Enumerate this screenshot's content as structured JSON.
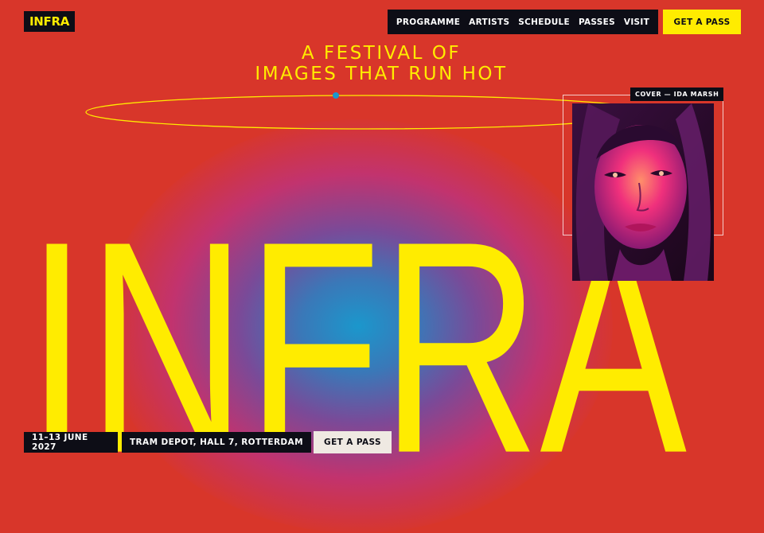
{
  "brand": {
    "logo": "INFRA"
  },
  "nav": {
    "items": [
      {
        "label": "PROGRAMME"
      },
      {
        "label": "ARTISTS"
      },
      {
        "label": "SCHEDULE"
      },
      {
        "label": "PASSES"
      },
      {
        "label": "VISIT"
      }
    ],
    "cta_label": "GET A PASS"
  },
  "hero": {
    "tagline_line1": "A FESTIVAL OF",
    "tagline_line2": "IMAGES THAT RUN HOT",
    "wordmark": "INFRA",
    "cover_label": "COVER — IDA MARSH"
  },
  "footer": {
    "date": "11–13 JUNE 2027",
    "venue": "TRAM DEPOT, HALL 7, ROTTERDAM",
    "cta_label": "GET A PASS"
  },
  "colors": {
    "background": "#d8362a",
    "accent": "#ffec00",
    "dark": "#0d0d16",
    "glow": "#1b97cc",
    "ring_dot": "#1b97cc"
  }
}
